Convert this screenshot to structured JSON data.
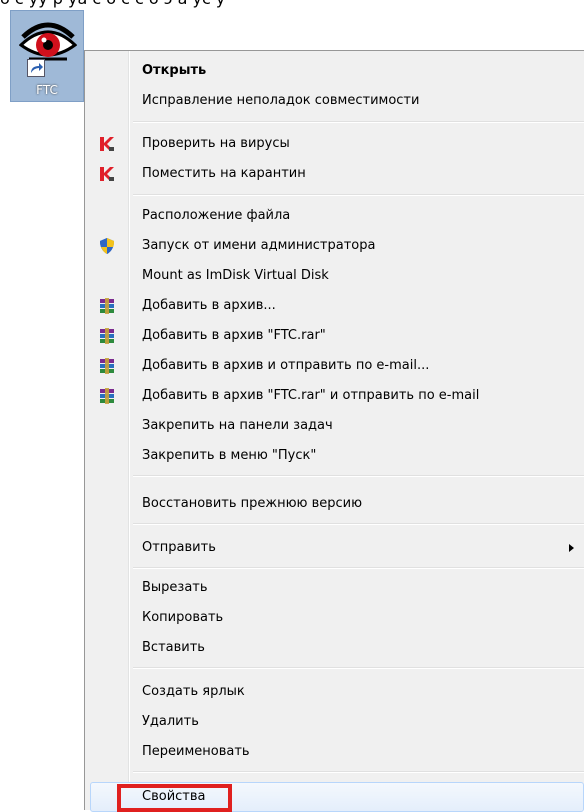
{
  "top_text": "о с уу р уа с о с с о э а ус у",
  "desktop_icon": {
    "label": "FTC"
  },
  "menu": {
    "items": [
      {
        "label": "Открыть",
        "bold": true,
        "icon": ""
      },
      {
        "label": "Исправление неполадок совместимости",
        "icon": ""
      },
      {
        "label": "Проверить на вирусы",
        "icon": "kaspersky-icon"
      },
      {
        "label": "Поместить на карантин",
        "icon": "kaspersky-icon"
      },
      {
        "label": "Расположение файла",
        "icon": ""
      },
      {
        "label": "Запуск от имени администратора",
        "icon": "uac-shield-icon"
      },
      {
        "label": "Mount as ImDisk Virtual Disk",
        "icon": ""
      },
      {
        "label": "Добавить в архив...",
        "icon": "winrar-icon"
      },
      {
        "label": "Добавить в архив \"FTC.rar\"",
        "icon": "winrar-icon"
      },
      {
        "label": "Добавить в архив и отправить по e-mail...",
        "icon": "winrar-icon"
      },
      {
        "label": "Добавить в архив \"FTC.rar\" и отправить по e-mail",
        "icon": "winrar-icon"
      },
      {
        "label": "Закрепить на панели задач",
        "icon": ""
      },
      {
        "label": "Закрепить в меню \"Пуск\"",
        "icon": ""
      },
      {
        "label": "Восстановить прежнюю версию",
        "icon": ""
      },
      {
        "label": "Отправить",
        "icon": "",
        "submenu": true
      },
      {
        "label": "Вырезать",
        "icon": ""
      },
      {
        "label": "Копировать",
        "icon": ""
      },
      {
        "label": "Вставить",
        "icon": ""
      },
      {
        "label": "Создать ярлык",
        "icon": ""
      },
      {
        "label": "Удалить",
        "icon": ""
      },
      {
        "label": "Переименовать",
        "icon": ""
      },
      {
        "label": "Свойства",
        "icon": "",
        "highlighted": true
      }
    ]
  },
  "colors": {
    "highlight_box": "#e0201f",
    "menu_bg": "#f0f0f0"
  }
}
